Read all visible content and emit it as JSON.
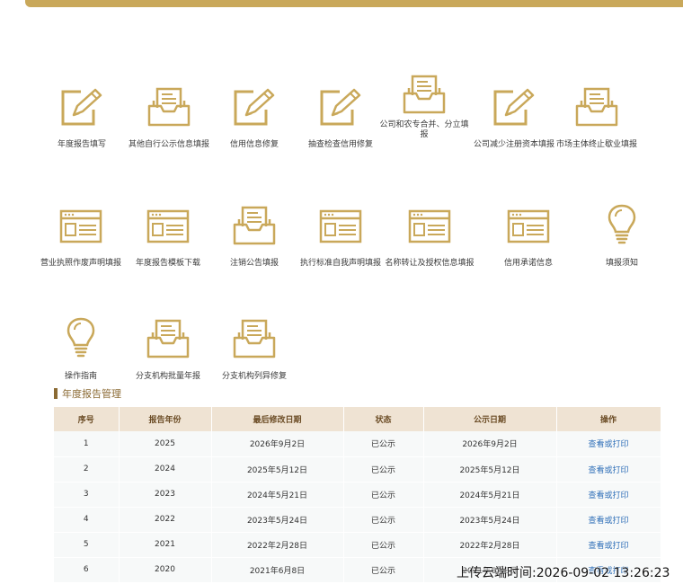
{
  "services": [
    {
      "label": "年度报告填写",
      "icon": "pencil-form-icon"
    },
    {
      "label": "其他自行公示信息填报",
      "icon": "document-tray-icon"
    },
    {
      "label": "信用信息修复",
      "icon": "pencil-form-icon"
    },
    {
      "label": "抽查检查信用修复",
      "icon": "pencil-form-icon"
    },
    {
      "label": "公司和农专合并、分立填报",
      "icon": "document-tray-icon"
    },
    {
      "label": "公司减少注册资本填报",
      "icon": "pencil-form-icon"
    },
    {
      "label": "市场主体终止歇业填报",
      "icon": "document-tray-icon"
    },
    {
      "label": "营业执照作废声明填报",
      "icon": "browser-window-icon"
    },
    {
      "label": "年度报告模板下载",
      "icon": "browser-window-icon"
    },
    {
      "label": "注销公告填报",
      "icon": "document-tray-icon"
    },
    {
      "label": "执行标准自我声明填报",
      "icon": "browser-window-icon"
    },
    {
      "label": "名称转让及授权信息填报",
      "icon": "browser-window-icon"
    },
    {
      "label": "信用承诺信息",
      "icon": "browser-window-icon"
    },
    {
      "label": "填报须知",
      "icon": "lightbulb-icon"
    },
    {
      "label": "操作指南",
      "icon": "lightbulb-icon"
    },
    {
      "label": "分支机构批量年报",
      "icon": "document-tray-icon"
    },
    {
      "label": "分支机构列异修复",
      "icon": "document-tray-icon"
    }
  ],
  "section": {
    "title": "年度报告管理"
  },
  "table": {
    "headers": [
      "序号",
      "报告年份",
      "最后修改日期",
      "状态",
      "公示日期",
      "操作"
    ],
    "rows": [
      [
        "1",
        "2025",
        "2026年9月2日",
        "已公示",
        "2026年9月2日",
        "查看或打印"
      ],
      [
        "2",
        "2024",
        "2025年5月12日",
        "已公示",
        "2025年5月12日",
        "查看或打印"
      ],
      [
        "3",
        "2023",
        "2024年5月21日",
        "已公示",
        "2024年5月21日",
        "查看或打印"
      ],
      [
        "4",
        "2022",
        "2023年5月24日",
        "已公示",
        "2023年5月24日",
        "查看或打印"
      ],
      [
        "5",
        "2021",
        "2022年2月28日",
        "已公示",
        "2022年2月28日",
        "查看或打印"
      ],
      [
        "6",
        "2020",
        "2021年6月8日",
        "已公示",
        "2021年6月8日",
        "查看或打印"
      ]
    ]
  },
  "watermark": "上传云端时间:2026-09-02 13:26:23",
  "colors": {
    "accent": "#c9a85a",
    "header_bg": "#efe3d3",
    "link": "#2f6fb8"
  }
}
